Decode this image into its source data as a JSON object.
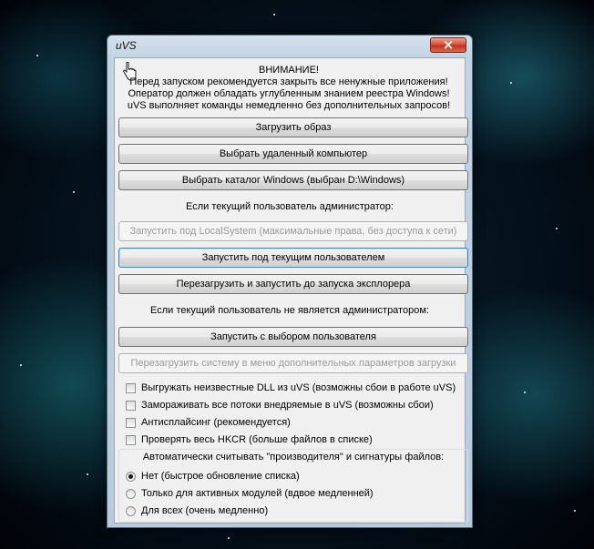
{
  "window": {
    "title": "uVS"
  },
  "warning": {
    "heading": "ВНИМАНИЕ!",
    "line1": "Перед запуском рекомендуется закрыть все ненужные приложения!",
    "line2": "Оператор должен обладать углубленным знанием реестра Windows!",
    "line3": "uVS выполняет команды немедленно без дополнительных запросов!"
  },
  "buttons": {
    "load_image": "Загрузить образ",
    "remote_computer": "Выбрать удаленный компьютер",
    "windows_dir": "Выбрать каталог Windows (выбран D:\\Windows)",
    "run_localsystem": "Запустить под LocalSystem (максимальные права, без доступа к сети)",
    "run_current_user": "Запустить под текущим пользователем",
    "reboot_before_explorer": "Перезагрузить и запустить до запуска эксплорера",
    "run_choose_user": "Запустить с выбором пользователя",
    "reboot_boot_menu": "Перезагрузить систему в меню дополнительных параметров загрузки"
  },
  "labels": {
    "if_admin": "Если текущий пользователь администратор:",
    "if_not_admin": "Если текущий пользователь не является администратором:"
  },
  "checkboxes": [
    {
      "label": "Выгружать неизвестные DLL из uVS (возможны сбои в работе uVS)",
      "checked": false
    },
    {
      "label": "Замораживать все потоки внедряемые в uVS (возможны сбои)",
      "checked": false
    },
    {
      "label": "Антисплайсинг (рекомендуется)",
      "checked": false
    },
    {
      "label": "Проверять весь HKCR (больше файлов в списке)",
      "checked": false
    }
  ],
  "radio_group": {
    "title": "Автоматически считывать \"производителя\" и сигнатуры файлов:",
    "options": [
      {
        "label": "Нет (быстрое обновление списка)",
        "checked": true
      },
      {
        "label": "Только для активных модулей (вдвое медленней)",
        "checked": false
      },
      {
        "label": "Для всех (очень медленно)",
        "checked": false
      }
    ]
  }
}
